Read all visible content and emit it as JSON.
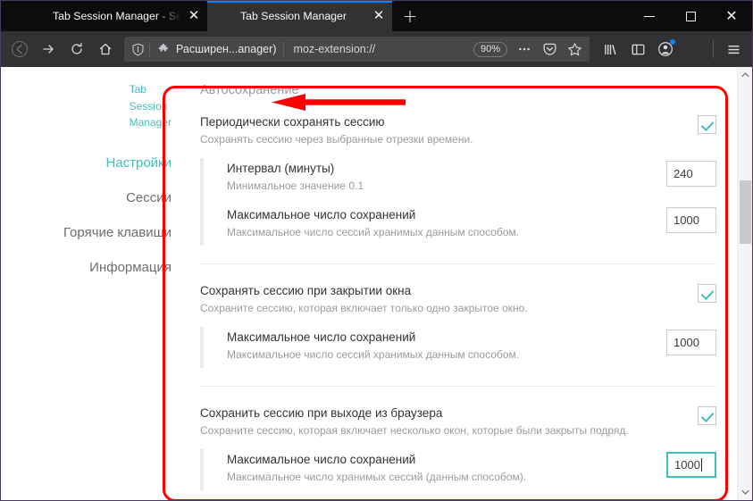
{
  "browser": {
    "tabs": [
      {
        "title": "Tab Session Manager - Sess",
        "favicon": "floppy-disk-icon",
        "active": false,
        "close_label": "✕"
      },
      {
        "title": "Tab Session Manager",
        "favicon": "floppy-disk-icon",
        "active": true,
        "close_label": "✕"
      }
    ],
    "new_tab_label": "+",
    "window_controls": {
      "minimize": "—",
      "maximize": "□",
      "close": "✕"
    },
    "toolbar": {
      "back_icon": "back-arrow-icon",
      "forward_icon": "forward-arrow-icon",
      "reload_icon": "reload-icon",
      "home_icon": "home-icon",
      "shield_icon": "shield-icon",
      "extension_identity": "Расширен...anager)",
      "url": "moz-extension://",
      "zoom_level": "90%",
      "page_actions_icon": "ellipsis-icon",
      "pocket_icon": "pocket-icon",
      "bookmark_icon": "star-icon",
      "library_icon": "library-icon",
      "sidebar_icon": "sidebar-icon",
      "account_icon": "account-icon",
      "extension_button_icon": "tab-session-manager-icon",
      "menu_icon": "hamburger-menu-icon"
    }
  },
  "sidebar": {
    "brand": {
      "logo": "floppy-disk-icon",
      "line1": "Tab",
      "line2": "Session",
      "line3": "Manager"
    },
    "items": [
      {
        "label": "Настройки",
        "active": true
      },
      {
        "label": "Сессии",
        "active": false
      },
      {
        "label": "Горячие клавиши",
        "active": false
      },
      {
        "label": "Информация",
        "active": false
      }
    ]
  },
  "main": {
    "section_title": "Автосохранение",
    "groups": [
      {
        "label": "Периодически сохранять сессию",
        "desc": "Сохранять сессию через выбранные отрезки времени.",
        "checked": true,
        "sub": [
          {
            "label": "Интервал (минуты)",
            "desc": "Минимальное значение 0.1",
            "value": "240",
            "focused": false
          },
          {
            "label": "Максимальное число сохранений",
            "desc": "Максимальное число сессий хранимых данным способом.",
            "value": "1000",
            "focused": false
          }
        ]
      },
      {
        "label": "Сохранять сессию при закрытии окна",
        "desc": "Сохраните сессию, которая включает только одно закрытое окно.",
        "checked": true,
        "sub": [
          {
            "label": "Максимальное число сохранений",
            "desc": "Максимальное число сессий хранимых данным способом.",
            "value": "1000",
            "focused": false
          }
        ]
      },
      {
        "label": "Сохранить сессию при выходе из браузера",
        "desc": "Сохраните сессию, которая включает несколько окон, которые были закрыты подряд.",
        "checked": true,
        "sub": [
          {
            "label": "Максимальное число сохранений",
            "desc": "Максимальное число хранимых сессий (данным способом).",
            "value": "1000",
            "focused": true
          }
        ]
      }
    ]
  },
  "scrollbar": {
    "up_arrow": "⌄",
    "down_arrow": "⌄"
  },
  "annotation": {
    "shape": "red-rounded-rectangle",
    "arrow": "red-left-arrow",
    "color": "#ff0000"
  },
  "colors": {
    "accent_teal": "#3fbfba",
    "tab_active_indicator": "#0a84ff",
    "chrome_dark": "#0c0c0d",
    "toolbar_dark": "#323234",
    "annotation_red": "#ff0000"
  }
}
